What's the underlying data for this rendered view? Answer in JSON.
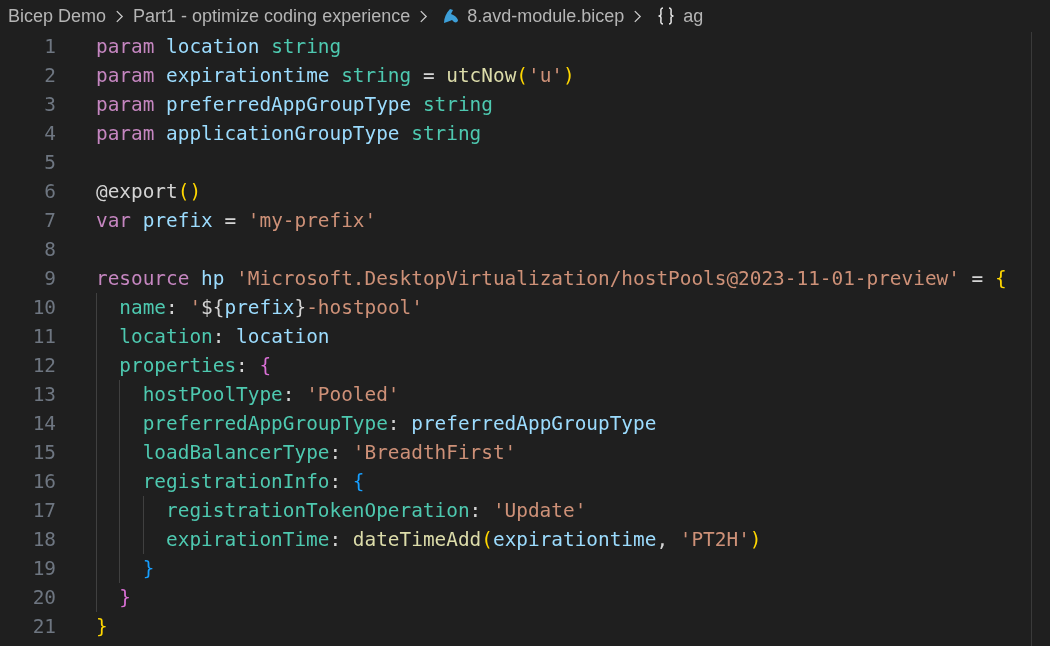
{
  "breadcrumb": [
    {
      "kind": "folder",
      "label": "Bicep Demo"
    },
    {
      "kind": "folder",
      "label": "Part1 - optimize coding experience"
    },
    {
      "kind": "file",
      "label": "8.avd-module.bicep"
    },
    {
      "kind": "symbol",
      "label": "ag"
    }
  ],
  "editor": {
    "lines": [
      {
        "number": "1",
        "tokens": [
          {
            "kind": "keyword",
            "text": "param "
          },
          {
            "kind": "variable",
            "text": "location "
          },
          {
            "kind": "type",
            "text": "string"
          }
        ]
      },
      {
        "number": "2",
        "tokens": [
          {
            "kind": "keyword",
            "text": "param "
          },
          {
            "kind": "variable",
            "text": "expirationtime "
          },
          {
            "kind": "type",
            "text": "string "
          },
          {
            "kind": "operator",
            "text": "= "
          },
          {
            "kind": "function",
            "text": "utcNow"
          },
          {
            "kind": "bracket1",
            "text": "("
          },
          {
            "kind": "string",
            "text": "'u'"
          },
          {
            "kind": "bracket1",
            "text": ")"
          }
        ]
      },
      {
        "number": "3",
        "tokens": [
          {
            "kind": "keyword",
            "text": "param "
          },
          {
            "kind": "variable",
            "text": "preferredAppGroupType "
          },
          {
            "kind": "type",
            "text": "string"
          }
        ]
      },
      {
        "number": "4",
        "tokens": [
          {
            "kind": "keyword",
            "text": "param "
          },
          {
            "kind": "variable",
            "text": "applicationGroupType "
          },
          {
            "kind": "type",
            "text": "string"
          }
        ]
      },
      {
        "number": "5"
      },
      {
        "number": "6",
        "tokens": [
          {
            "kind": "decorator",
            "text": "@export"
          },
          {
            "kind": "bracket1",
            "text": "()"
          }
        ]
      },
      {
        "number": "7",
        "tokens": [
          {
            "kind": "keyword",
            "text": "var "
          },
          {
            "kind": "variable",
            "text": "prefix "
          },
          {
            "kind": "operator",
            "text": "= "
          },
          {
            "kind": "string",
            "text": "'my-prefix'"
          }
        ]
      },
      {
        "number": "8"
      },
      {
        "number": "9",
        "tokens": [
          {
            "kind": "keyword",
            "text": "resource "
          },
          {
            "kind": "variable",
            "text": "hp "
          },
          {
            "kind": "string",
            "text": "'Microsoft.DesktopVirtualization/hostPools@2023-11-01-preview' "
          },
          {
            "kind": "operator",
            "text": "= "
          },
          {
            "kind": "bracket1",
            "text": "{"
          }
        ],
        "children": [
          {
            "number": "10",
            "tokens": [
              {
                "kind": "property",
                "text": "name"
              },
              {
                "kind": "operator",
                "text": ": "
              },
              {
                "kind": "string",
                "text": "'"
              },
              {
                "kind": "operator",
                "text": "${"
              },
              {
                "kind": "variable",
                "text": "prefix"
              },
              {
                "kind": "operator",
                "text": "}"
              },
              {
                "kind": "string",
                "text": "-hostpool'"
              }
            ]
          },
          {
            "number": "11",
            "tokens": [
              {
                "kind": "property",
                "text": "location"
              },
              {
                "kind": "operator",
                "text": ": "
              },
              {
                "kind": "variable",
                "text": "location"
              }
            ]
          },
          {
            "number": "12",
            "tokens": [
              {
                "kind": "property",
                "text": "properties"
              },
              {
                "kind": "operator",
                "text": ": "
              },
              {
                "kind": "bracket2",
                "text": "{"
              }
            ],
            "children": [
              {
                "number": "13",
                "tokens": [
                  {
                    "kind": "property",
                    "text": "hostPoolType"
                  },
                  {
                    "kind": "operator",
                    "text": ": "
                  },
                  {
                    "kind": "string",
                    "text": "'Pooled'"
                  }
                ]
              },
              {
                "number": "14",
                "tokens": [
                  {
                    "kind": "property",
                    "text": "preferredAppGroupType"
                  },
                  {
                    "kind": "operator",
                    "text": ": "
                  },
                  {
                    "kind": "variable",
                    "text": "preferredAppGroupType"
                  }
                ]
              },
              {
                "number": "15",
                "tokens": [
                  {
                    "kind": "property",
                    "text": "loadBalancerType"
                  },
                  {
                    "kind": "operator",
                    "text": ": "
                  },
                  {
                    "kind": "string",
                    "text": "'BreadthFirst'"
                  }
                ]
              },
              {
                "number": "16",
                "tokens": [
                  {
                    "kind": "property",
                    "text": "registrationInfo"
                  },
                  {
                    "kind": "operator",
                    "text": ": "
                  },
                  {
                    "kind": "bracket3",
                    "text": "{"
                  }
                ],
                "children": [
                  {
                    "number": "17",
                    "tokens": [
                      {
                        "kind": "property",
                        "text": "registrationTokenOperation"
                      },
                      {
                        "kind": "operator",
                        "text": ": "
                      },
                      {
                        "kind": "string",
                        "text": "'Update'"
                      }
                    ]
                  },
                  {
                    "number": "18",
                    "tokens": [
                      {
                        "kind": "property",
                        "text": "expirationTime"
                      },
                      {
                        "kind": "operator",
                        "text": ": "
                      },
                      {
                        "kind": "function",
                        "text": "dateTimeAdd"
                      },
                      {
                        "kind": "bracket1",
                        "text": "("
                      },
                      {
                        "kind": "variable",
                        "text": "expirationtime"
                      },
                      {
                        "kind": "operator",
                        "text": ", "
                      },
                      {
                        "kind": "string",
                        "text": "'PT2H'"
                      },
                      {
                        "kind": "bracket1",
                        "text": ")"
                      }
                    ]
                  }
                ]
              },
              {
                "number": "19",
                "tokens": [
                  {
                    "kind": "bracket3",
                    "text": "}"
                  }
                ]
              }
            ]
          },
          {
            "number": "20",
            "tokens": [
              {
                "kind": "bracket2",
                "text": "}"
              }
            ]
          }
        ]
      },
      {
        "number": "21",
        "tokens": [
          {
            "kind": "bracket1",
            "text": "}"
          }
        ]
      }
    ]
  }
}
